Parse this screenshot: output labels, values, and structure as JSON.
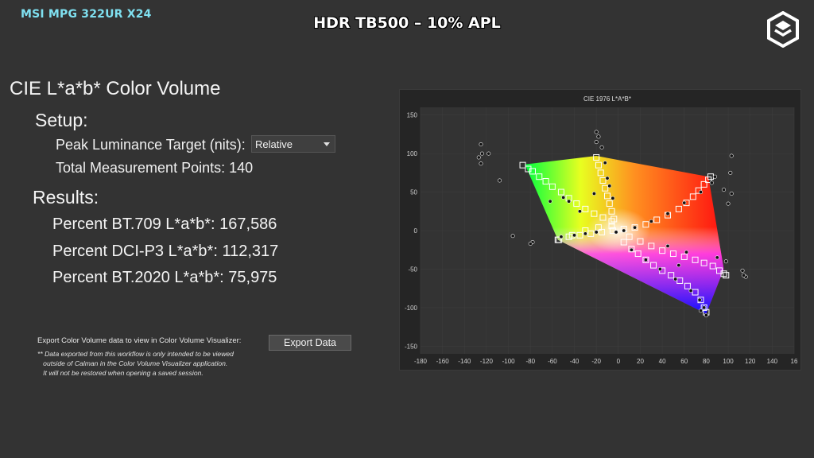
{
  "header": {
    "monitor_name": "MSI MPG 322UR X24",
    "title": "HDR TB500 – 10% APL"
  },
  "logo": {
    "icon": "brand-logo-icon"
  },
  "main": {
    "heading": "CIE L*a*b* Color Volume",
    "setup_label": "Setup:",
    "peak_label": "Peak Luminance Target (nits):",
    "peak_value": "Relative",
    "total_points": "Total Measurement Points: 140",
    "results_label": "Results:",
    "results": [
      "Percent BT.709 L*a*b*: 167,586",
      "Percent DCI-P3 L*a*b*: 112,317",
      "Percent BT.2020 L*a*b*: 75,975"
    ],
    "export_label": "Export Color Volume data to view in Color Volume Visualizer:",
    "export_note": "** Data exported from this workflow is only intended to be viewed\n   outside of Calman in the Color Volume Visualizer application.\n   It will not be restored when opening a saved session.",
    "export_button": "Export Data"
  },
  "chart_data": {
    "type": "scatter",
    "title": "CIE 1976 L*A*B*",
    "xlabel": "",
    "ylabel": "",
    "xlim": [
      -180,
      160
    ],
    "ylim": [
      -160,
      160
    ],
    "x_ticks": [
      "-180",
      "-160",
      "-140",
      "-120",
      "-100",
      "-80",
      "-60",
      "-40",
      "-20",
      "0",
      "20",
      "40",
      "60",
      "80",
      "100",
      "120",
      "140",
      "16"
    ],
    "y_ticks": [
      "150",
      "100",
      "50",
      "0",
      "-50",
      "-100",
      "-150"
    ],
    "grid": true,
    "colors": {
      "background": "#333333",
      "accent": "#7fe0f0"
    },
    "gamut_vertices": [
      [
        -85,
        86
      ],
      [
        -20,
        97
      ],
      [
        82,
        70
      ],
      [
        96,
        -50
      ],
      [
        80,
        -108
      ],
      [
        -55,
        -12
      ]
    ],
    "series": [
      {
        "marker": "square",
        "points": [
          [
            -87,
            85
          ],
          [
            -82,
            80
          ],
          [
            -78,
            77
          ],
          [
            -72,
            70
          ],
          [
            -66,
            64
          ],
          [
            -60,
            57
          ],
          [
            -52,
            50
          ],
          [
            -45,
            42
          ],
          [
            -38,
            35
          ],
          [
            -30,
            28
          ],
          [
            -22,
            22
          ],
          [
            -14,
            17
          ],
          [
            -6,
            12
          ],
          [
            -54,
            -12
          ],
          [
            -45,
            -8
          ],
          [
            -35,
            -6
          ],
          [
            -25,
            -4
          ],
          [
            -15,
            -2
          ],
          [
            -5,
            0
          ],
          [
            5,
            2
          ],
          [
            15,
            4
          ],
          [
            25,
            8
          ],
          [
            35,
            14
          ],
          [
            45,
            20
          ],
          [
            55,
            28
          ],
          [
            62,
            36
          ],
          [
            68,
            44
          ],
          [
            73,
            52
          ],
          [
            78,
            60
          ],
          [
            82,
            66
          ],
          [
            84,
            70
          ],
          [
            -20,
            95
          ],
          [
            -18,
            85
          ],
          [
            -16,
            75
          ],
          [
            -14,
            65
          ],
          [
            -12,
            55
          ],
          [
            -10,
            45
          ],
          [
            -8,
            35
          ],
          [
            -6,
            25
          ],
          [
            -4,
            15
          ],
          [
            5,
            -15
          ],
          [
            12,
            -24
          ],
          [
            18,
            -30
          ],
          [
            25,
            -38
          ],
          [
            32,
            -45
          ],
          [
            40,
            -52
          ],
          [
            48,
            -58
          ],
          [
            56,
            -65
          ],
          [
            63,
            -72
          ],
          [
            70,
            -80
          ],
          [
            75,
            -90
          ],
          [
            78,
            -100
          ],
          [
            80,
            -106
          ],
          [
            10,
            -8
          ],
          [
            20,
            -14
          ],
          [
            30,
            -20
          ],
          [
            40,
            -26
          ],
          [
            50,
            -30
          ],
          [
            60,
            -34
          ],
          [
            70,
            -38
          ],
          [
            78,
            -42
          ],
          [
            86,
            -46
          ],
          [
            92,
            -52
          ],
          [
            96,
            -56
          ],
          [
            98,
            -58
          ],
          [
            -55,
            -12
          ],
          [
            -42,
            -6
          ],
          [
            -30,
            0
          ],
          [
            -18,
            4
          ],
          [
            -6,
            6
          ]
        ]
      },
      {
        "marker": "dot",
        "points": [
          [
            -125,
            112
          ],
          [
            -124,
            100
          ],
          [
            -127,
            95
          ],
          [
            -125,
            87
          ],
          [
            -108,
            65
          ],
          [
            -118,
            100
          ],
          [
            -62,
            38
          ],
          [
            -50,
            43
          ],
          [
            -45,
            38
          ],
          [
            -35,
            25
          ],
          [
            -52,
            -8
          ],
          [
            -40,
            -6
          ],
          [
            -30,
            -4
          ],
          [
            -20,
            -2
          ],
          [
            -2,
            -2
          ],
          [
            5,
            0
          ],
          [
            15,
            4
          ],
          [
            30,
            12
          ],
          [
            45,
            22
          ],
          [
            60,
            36
          ],
          [
            75,
            50
          ],
          [
            85,
            62
          ],
          [
            88,
            70
          ],
          [
            103,
            97
          ],
          [
            102,
            75
          ],
          [
            96,
            53
          ],
          [
            103,
            48
          ],
          [
            100,
            35
          ],
          [
            -20,
            128
          ],
          [
            -18,
            122
          ],
          [
            -20,
            115
          ],
          [
            -15,
            108
          ],
          [
            -12,
            88
          ],
          [
            -10,
            68
          ],
          [
            -8,
            58
          ],
          [
            -5,
            42
          ],
          [
            -22,
            48
          ],
          [
            -78,
            -15
          ],
          [
            -96,
            -7
          ],
          [
            -80,
            -17
          ],
          [
            12,
            -25
          ],
          [
            25,
            -38
          ],
          [
            38,
            -50
          ],
          [
            52,
            -63
          ],
          [
            66,
            -78
          ],
          [
            74,
            -90
          ],
          [
            78,
            -100
          ],
          [
            80,
            -110
          ],
          [
            75,
            -104
          ],
          [
            113,
            -52
          ],
          [
            116,
            -60
          ],
          [
            114,
            -58
          ],
          [
            90,
            -35
          ],
          [
            98,
            -40
          ],
          [
            45,
            -20
          ],
          [
            62,
            -28
          ],
          [
            55,
            -45
          ]
        ]
      }
    ]
  }
}
